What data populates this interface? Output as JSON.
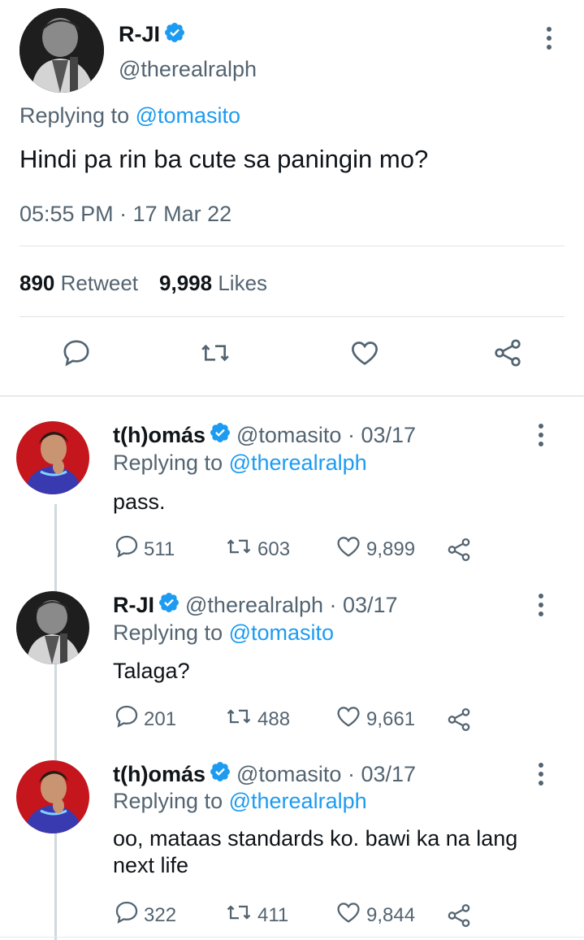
{
  "main_tweet": {
    "name": "R-JI",
    "handle": "@therealralph",
    "replying_prefix": "Replying to",
    "replying_to": "@tomasito",
    "text": "Hindi pa rin ba cute sa paningin mo?",
    "timestamp": "05:55 PM · 17 Mar 22",
    "retweet_count": "890",
    "retweet_label": "Retweet",
    "like_count": "9,998",
    "like_label": "Likes"
  },
  "replies": [
    {
      "name": "t(h)omás",
      "meta": "@tomasito · 03/17",
      "replying_prefix": "Replying to",
      "replying_to": "@therealralph",
      "text": "pass.",
      "reply_count": "511",
      "retweet_count": "603",
      "like_count": "9,899"
    },
    {
      "name": "R-JI",
      "meta": "@therealralph · 03/17",
      "replying_prefix": "Replying to",
      "replying_to": "@tomasito",
      "text": "Talaga?",
      "reply_count": "201",
      "retweet_count": "488",
      "like_count": "9,661"
    },
    {
      "name": "t(h)omás",
      "meta": "@tomasito · 03/17",
      "replying_prefix": "Replying to",
      "replying_to": "@therealralph",
      "text": "oo, mataas standards ko. bawi ka na lang next life",
      "reply_count": "322",
      "retweet_count": "411",
      "like_count": "9,844"
    }
  ],
  "colors": {
    "accent": "#1d9bf0",
    "secondary_text": "#536471",
    "primary_text": "#0f1419"
  },
  "icons": [
    "verified-badge-icon",
    "more-options-icon",
    "reply-icon",
    "retweet-icon",
    "like-icon",
    "share-icon"
  ]
}
